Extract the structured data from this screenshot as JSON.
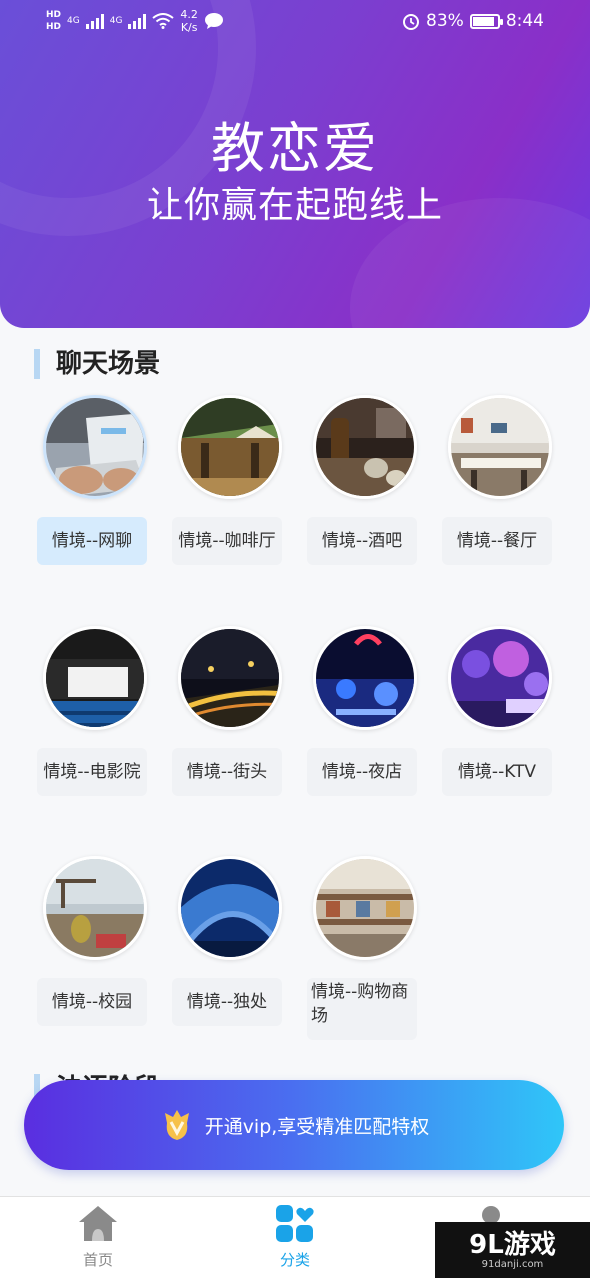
{
  "status": {
    "network_left": "HD",
    "network_left2": "HD",
    "net1": "4G",
    "net2": "4G",
    "speed_value": "4.2",
    "speed_unit": "K/s",
    "battery": "83%",
    "time": "8:44"
  },
  "hero": {
    "title": "教恋爱",
    "subtitle": "让你赢在起跑线上"
  },
  "section1": {
    "title": "聊天场景"
  },
  "scenes": [
    {
      "label": "情境--网聊",
      "active": true
    },
    {
      "label": "情境--咖啡厅"
    },
    {
      "label": "情境--酒吧"
    },
    {
      "label": "情境--餐厅"
    },
    {
      "label": "情境--电影院"
    },
    {
      "label": "情境--街头"
    },
    {
      "label": "情境--夜店"
    },
    {
      "label": "情境--KTV"
    },
    {
      "label": "情境--校园"
    },
    {
      "label": "情境--独处"
    },
    {
      "label": "情境--购物商场"
    }
  ],
  "section2": {
    "title": "法语阶段"
  },
  "vip": {
    "text": "开通vip,享受精准匹配特权",
    "icon": "vip-crown-icon"
  },
  "tabs": [
    {
      "label": "首页",
      "icon": "home-icon"
    },
    {
      "label": "分类",
      "icon": "category-icon",
      "active": true
    },
    {
      "label": "",
      "icon": "profile-icon"
    }
  ],
  "watermark": {
    "big": "9L游戏",
    "small": "91danji.com"
  },
  "colors": {
    "accent": "#1aa3e8",
    "hero_start": "#6a4fd8",
    "hero_end": "#8a2fc8",
    "vip_start": "#5a2ee0",
    "vip_end": "#2fc6f8"
  }
}
